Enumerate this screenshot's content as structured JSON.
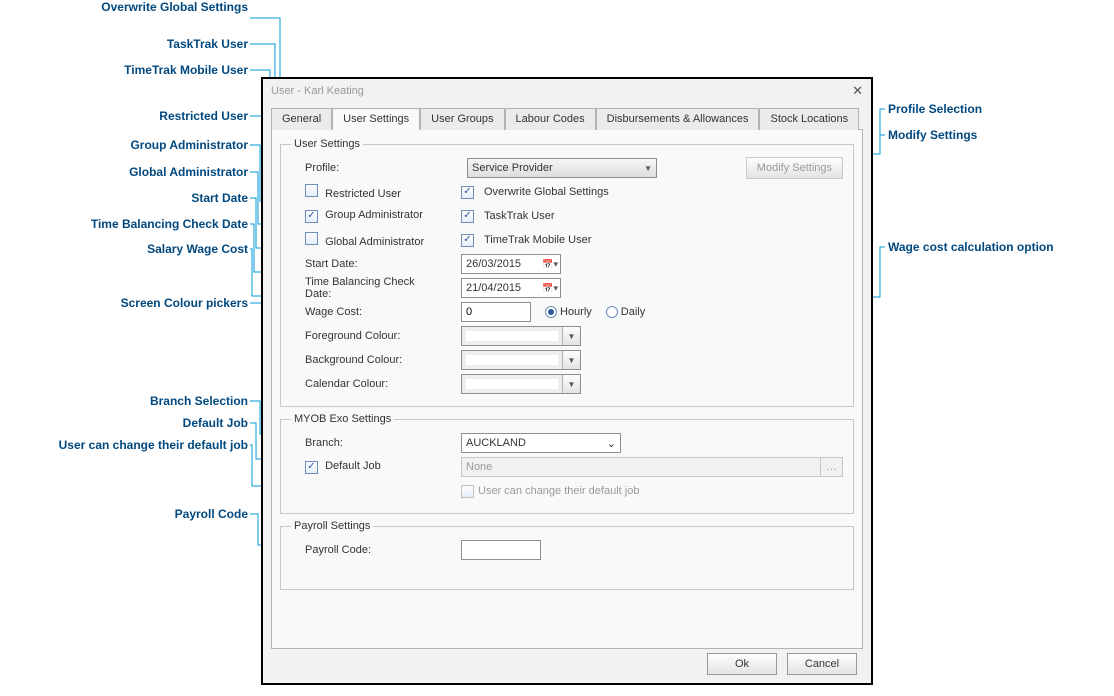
{
  "window": {
    "title": "User - Karl Keating"
  },
  "tabs": [
    "General",
    "User Settings",
    "User Groups",
    "Labour Codes",
    "Disbursements & Allowances",
    "Stock Locations"
  ],
  "userSettings": {
    "legend": "User Settings",
    "profileLabel": "Profile:",
    "profileValue": "Service Provider",
    "modifySettings": "Modify Settings",
    "restrictedUser": "Restricted User",
    "groupAdministrator": "Group Administrator",
    "globalAdministrator": "Global Administrator",
    "overwriteGlobal": "Overwrite Global Settings",
    "taskTrakUser": "TaskTrak User",
    "timeTrakMobileUser": "TimeTrak Mobile User",
    "startDateLabel": "Start Date:",
    "startDate": "26/03/2015",
    "timeBalLabel": "Time Balancing Check Date:",
    "timeBalDate": "21/04/2015",
    "wageCostLabel": "Wage Cost:",
    "wageCostValue": "0",
    "hourly": "Hourly",
    "daily": "Daily",
    "fgColourLabel": "Foreground Colour:",
    "bgColourLabel": "Background Colour:",
    "calColourLabel": "Calendar Colour:"
  },
  "exo": {
    "legend": "MYOB Exo Settings",
    "branchLabel": "Branch:",
    "branchValue": "AUCKLAND",
    "defaultJobLabel": "Default Job",
    "defaultJobValue": "None",
    "userCanChange": "User can change their default job"
  },
  "payroll": {
    "legend": "Payroll Settings",
    "codeLabel": "Payroll Code:",
    "codeValue": ""
  },
  "footer": {
    "ok": "Ok",
    "cancel": "Cancel"
  },
  "callouts": {
    "overwriteGlobal": "Overwrite Global Settings",
    "taskTrakUser": "TaskTrak User",
    "timeTrakMobileUser": "TimeTrak Mobile User",
    "restrictedUser": "Restricted User",
    "groupAdministrator": "Group Administrator",
    "globalAdministrator": "Global Administrator",
    "startDate": "Start Date",
    "timeBalancing": "Time Balancing Check Date",
    "salaryWageCost": "Salary Wage Cost",
    "screenColourPickers": "Screen Colour pickers",
    "branchSelection": "Branch Selection",
    "defaultJob": "Default Job",
    "userCanChange": "User can change their default job",
    "payrollCode": "Payroll Code",
    "profileSelection": "Profile Selection",
    "modifySettings": "Modify Settings",
    "wageCostOption": "Wage cost calculation option"
  }
}
